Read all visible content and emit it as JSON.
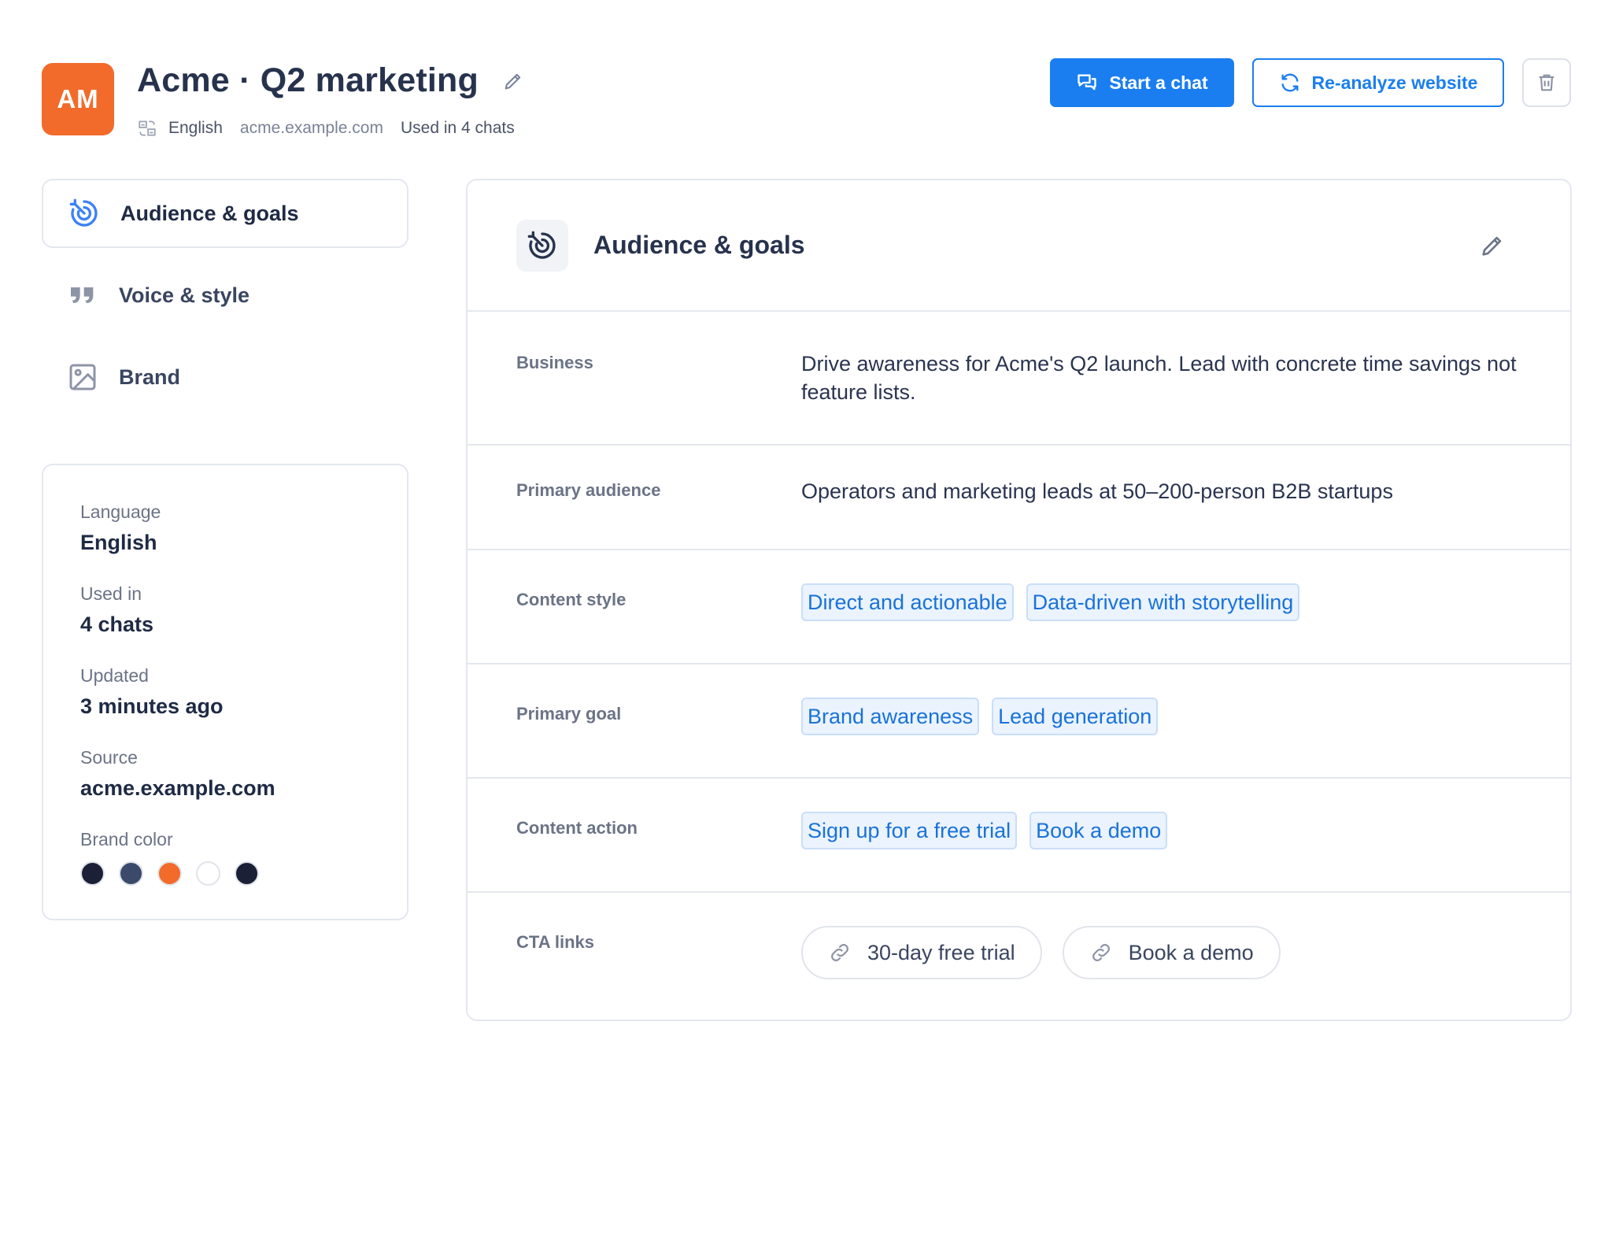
{
  "header": {
    "avatar_initials": "AM",
    "title": "Acme · Q2 marketing",
    "meta": {
      "language": "English",
      "website": "acme.example.com",
      "usage": "Used in 4 chats"
    },
    "start_chat_label": "Start a chat",
    "reanalyze_label": "Re-analyze website"
  },
  "nav": {
    "items": [
      {
        "label": "Audience & goals",
        "icon": "target-icon",
        "active": true
      },
      {
        "label": "Voice & style",
        "icon": "quote-icon",
        "active": false
      },
      {
        "label": "Brand",
        "icon": "image-icon",
        "active": false
      }
    ]
  },
  "info": {
    "language_label": "Language",
    "language_value": "English",
    "used_label": "Used in",
    "used_value": "4 chats",
    "updated_label": "Updated",
    "updated_value": "3 minutes ago",
    "source_label": "Source",
    "source_value": "acme.example.com",
    "brand_color_label": "Brand color",
    "brand_colors": [
      "#1b2036",
      "#3b4a6b",
      "#f26b2a",
      "#ffffff",
      "#1b2036"
    ]
  },
  "panel": {
    "title": "Audience & goals",
    "rows": {
      "business_label": "Business",
      "business_value": "Drive awareness for Acme's Q2 launch. Lead with concrete time savings not feature lists.",
      "audience_label": "Primary audience",
      "audience_value": "Operators and marketing leads at 50–200-person B2B startups",
      "style_label": "Content style",
      "style_tags": [
        "Direct and actionable",
        "Data-driven with storytelling"
      ],
      "goal_label": "Primary goal",
      "goal_tags": [
        "Brand awareness",
        "Lead generation"
      ],
      "action_label": "Content action",
      "action_tags": [
        "Sign up for a free trial",
        "Book a demo"
      ],
      "cta_label": "CTA links",
      "cta_links": [
        "30-day free trial",
        "Book a demo"
      ]
    }
  },
  "colors": {
    "accent": "#1a7ef0",
    "avatar": "#f26b2a",
    "chip_bg": "#eaf3fe",
    "chip_text": "#1a72d8"
  }
}
